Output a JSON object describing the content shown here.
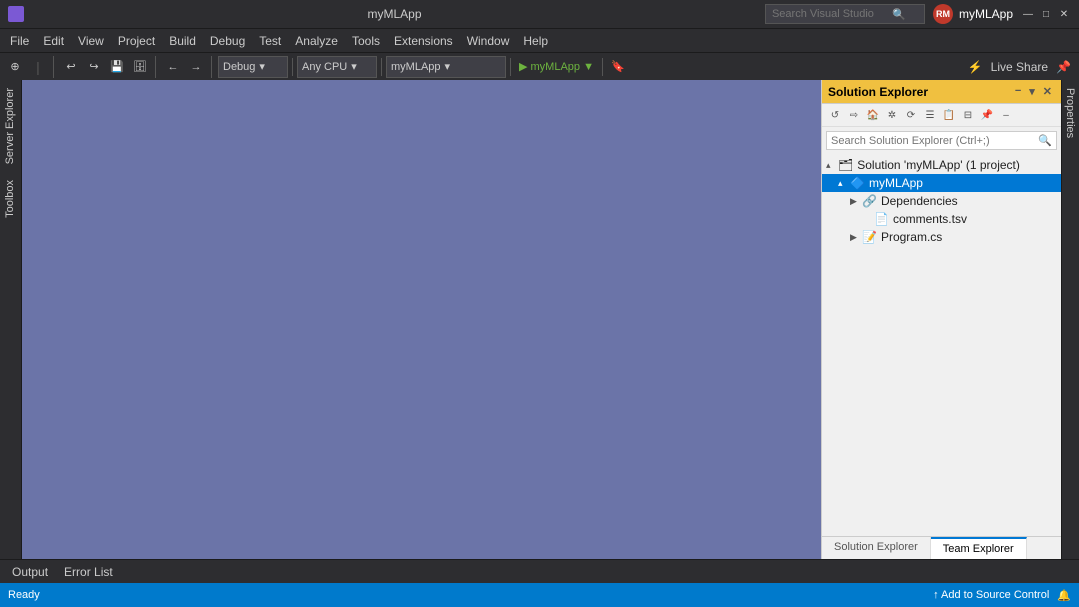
{
  "titleBar": {
    "appName": "myMLApp",
    "userInitials": "RM",
    "searchPlaceholder": "Search Visual Studio",
    "windowControls": [
      "—",
      "□",
      "✕"
    ]
  },
  "menuBar": {
    "items": [
      "File",
      "Edit",
      "View",
      "Project",
      "Build",
      "Debug",
      "Test",
      "Analyze",
      "Tools",
      "Extensions",
      "Window",
      "Help"
    ]
  },
  "liveShare": {
    "label": "Live Share",
    "extensionsIcon": "⚡"
  },
  "toolbar": {
    "debugMode": "Debug",
    "platform": "Any CPU",
    "project": "myMLApp",
    "startLabel": "▶ myMLApp ▼",
    "bookmarkLabel": "🔖"
  },
  "leftSidebar": {
    "tabs": [
      "Server Explorer",
      "Toolbox"
    ]
  },
  "rightSidebar": {
    "tabs": [
      "Properties"
    ]
  },
  "solutionExplorer": {
    "title": "Solution Explorer",
    "searchPlaceholder": "Search Solution Explorer (Ctrl+;)",
    "tree": [
      {
        "level": 0,
        "label": "Solution 'myMLApp' (1 project)",
        "icon": "🗂",
        "expanded": true,
        "selected": false
      },
      {
        "level": 1,
        "label": "myMLApp",
        "icon": "🔷",
        "expanded": true,
        "selected": true
      },
      {
        "level": 2,
        "label": "Dependencies",
        "icon": "🔗",
        "expanded": false,
        "selected": false
      },
      {
        "level": 2,
        "label": "comments.tsv",
        "icon": "📄",
        "expanded": false,
        "selected": false
      },
      {
        "level": 2,
        "label": "Program.cs",
        "icon": "📝",
        "expanded": false,
        "selected": false
      }
    ],
    "tabs": [
      {
        "label": "Solution Explorer",
        "active": false
      },
      {
        "label": "Team Explorer",
        "active": true
      }
    ],
    "toolbar": [
      "↺",
      "⇨",
      "🏠",
      "✲",
      "⟳",
      "☰",
      "📋",
      "⊟",
      "📌",
      "–"
    ]
  },
  "bottomTabs": {
    "items": [
      "Output",
      "Error List"
    ]
  },
  "statusBar": {
    "status": "Ready",
    "addToSourceControl": "↑ Add to Source Control",
    "notificationIcon": "🔔"
  }
}
